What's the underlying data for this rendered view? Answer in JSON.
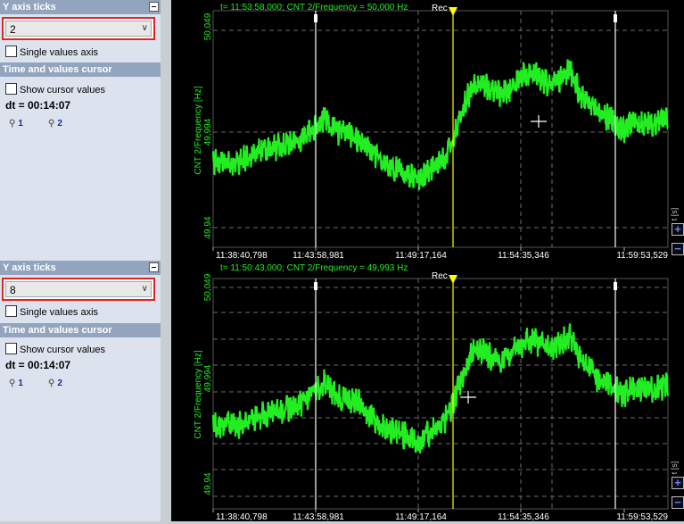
{
  "panels": [
    {
      "y_axis_ticks": {
        "header": "Y axis ticks",
        "value": "2"
      },
      "single_values_axis": "Single values axis",
      "cursor_section": "Time and values cursor",
      "show_cursor_values": "Show cursor values",
      "dt": "dt = 00:14:07",
      "cursor1": "1",
      "cursor2": "2"
    },
    {
      "y_axis_ticks": {
        "header": "Y axis ticks",
        "value": "8"
      },
      "single_values_axis": "Single values axis",
      "cursor_section": "Time and values cursor",
      "show_cursor_values": "Show cursor values",
      "dt": "dt = 00:14:07",
      "cursor1": "1",
      "cursor2": "2"
    }
  ],
  "charts": [
    {
      "readout": "t= 11:53:58,000; CNT 2/Frequency = 50,000 Hz",
      "rec": "Rec",
      "ylabel": "CNT 2/Frequency [Hz]",
      "yticks": [
        "50,049",
        "49,994",
        "49,94"
      ],
      "xticks": [
        "11:38:40,798",
        "11:43:58,981",
        "11:49:17,164",
        "11:54:35,346",
        "11:59:53,529"
      ],
      "t_unit": "t [s]",
      "grid_rows": 2
    },
    {
      "readout": "t= 11:50:43,000; CNT 2/Frequency = 49,993 Hz",
      "rec": "Rec",
      "ylabel": "CNT 2/Frequency [Hz]",
      "yticks": [
        "50,049",
        "49,994",
        "49,94"
      ],
      "xticks": [
        "11:38:40,798",
        "11:43:58,981",
        "11:49:17,164",
        "11:54:35,346",
        "11:59:53,529"
      ],
      "t_unit": "t [s]",
      "grid_rows": 8
    }
  ],
  "colors": {
    "signal": "#22ee22",
    "cursor": "#ffff00",
    "marker": "#ffffff"
  }
}
